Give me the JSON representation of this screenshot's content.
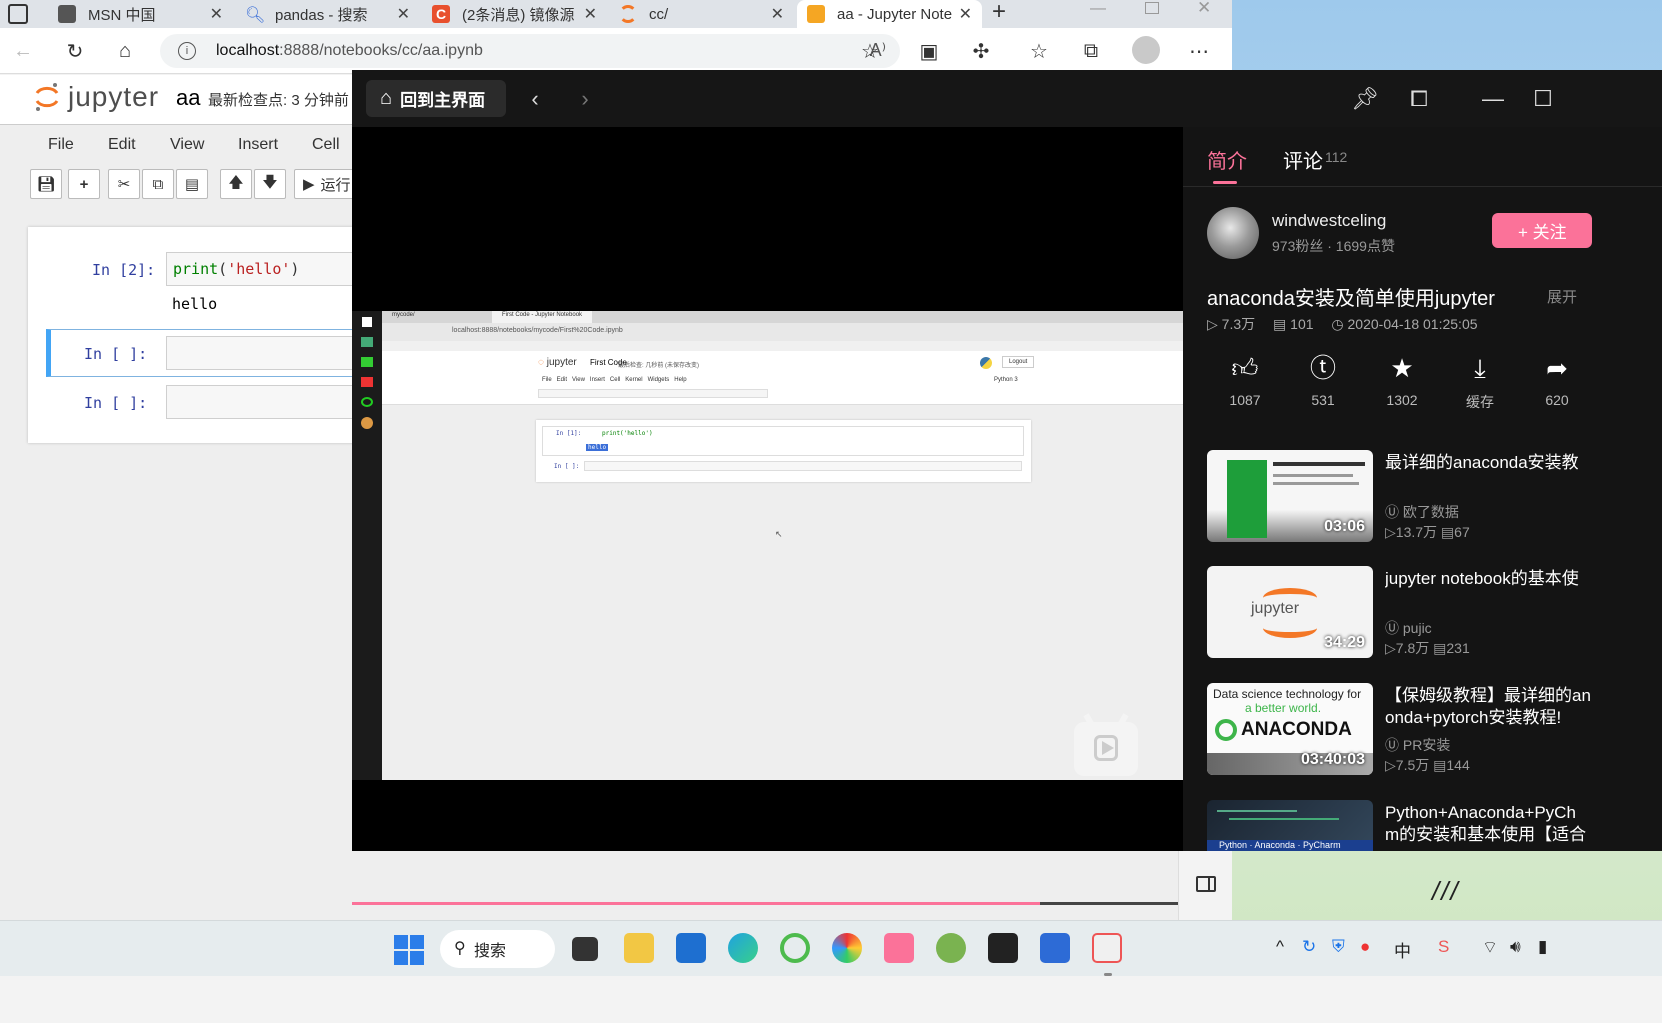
{
  "browser": {
    "tabs": [
      {
        "label": "MSN 中国",
        "icon": "msn-icon"
      },
      {
        "label": "pandas - 搜索",
        "icon": "search-icon"
      },
      {
        "label": "(2条消息) 镜像源",
        "icon": "csdn-icon"
      },
      {
        "label": "cc/",
        "icon": "jupyter-icon"
      },
      {
        "label": "aa - Jupyter Note",
        "icon": "jupyter-notebook-icon",
        "active": true
      }
    ],
    "url_host": "localhost",
    "url_path": ":8888/notebooks/cc/aa.ipynb"
  },
  "jupyter": {
    "logo_text": "jupyter",
    "notebook_name": "aa",
    "checkpoint": "最新检查点: 3 分钟前",
    "menu": [
      "File",
      "Edit",
      "View",
      "Insert",
      "Cell"
    ],
    "run_label": "运行",
    "cells": [
      {
        "prompt": "In  [2]:",
        "code": "print('hello')",
        "output": "hello"
      },
      {
        "prompt": "In  [ ]:",
        "code": ""
      },
      {
        "prompt": "In  [ ]:",
        "code": ""
      }
    ]
  },
  "bili": {
    "home_label": "回到主界面",
    "tab_intro": "简介",
    "tab_comments": "评论",
    "comment_count": "112",
    "author_name": "windwestceling",
    "author_stats": "973粉丝 · 1699点赞",
    "follow_label": "+ 关注",
    "video_title": "anaconda安装及简单使用jupyter",
    "expand_label": "展开",
    "views": "7.3万",
    "danmaku": "101",
    "date": "2020-04-18 01:25:05",
    "actions": [
      {
        "icon": "like-icon",
        "label": "1087"
      },
      {
        "icon": "coin-icon",
        "label": "531"
      },
      {
        "icon": "favorite-icon",
        "label": "1302"
      },
      {
        "icon": "cache-icon",
        "label": "缓存"
      },
      {
        "icon": "share-icon",
        "label": "620"
      }
    ],
    "recommendations": [
      {
        "title": "最详细的anaconda安装教",
        "uploader": "欧了数据",
        "views": "13.7万",
        "comments": "67",
        "duration": "03:06"
      },
      {
        "title": "jupyter notebook的基本使",
        "uploader": "pujic",
        "views": "7.8万",
        "comments": "231",
        "duration": "34:29"
      },
      {
        "title": "【保姆级教程】最详细的an",
        "title2": "onda+pytorch安装教程!",
        "uploader": "PR安装",
        "views": "7.5万",
        "comments": "144",
        "duration": "03:40:03"
      },
      {
        "title": "Python+Anaconda+PyCh",
        "title2": "m的安装和基本使用【适合"
      }
    ],
    "rec_thumb_texts": {
      "jupyter": "jupyter",
      "ds_line1": "Data science technology for",
      "ds_line2": "a better world.",
      "anaconda": "ANACONDA",
      "bottom_strip": "Python · Anaconda · PyCharm"
    },
    "inner_video": {
      "tab1": "mycode/",
      "tab2": "First Code - Jupyter Notebook",
      "url": "localhost:8888/notebooks/mycode/First%20Code.ipynb",
      "nb_title": "First Code",
      "nb_ckpt": "最后检查: 几秒前 (未保存改变)",
      "logout": "Logout",
      "menu": "File   Edit   View   Insert   Cell   Kernel   Widgets   Help",
      "kernel": "Python 3",
      "cell_code": "print('hello')",
      "cell_prompt": "In [1]:",
      "cell_out": "hello",
      "empty_prompt": "In [ ]:"
    }
  },
  "taskbar": {
    "search_label": "搜索",
    "lang": "中"
  }
}
